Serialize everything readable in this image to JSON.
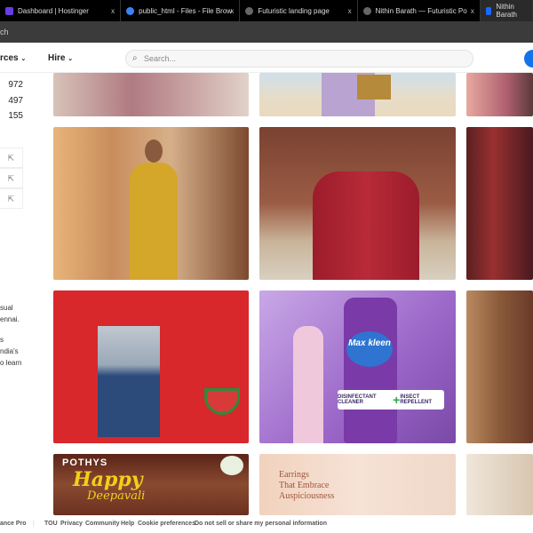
{
  "browser": {
    "tabs": [
      {
        "title": "Dashboard | Hostinger",
        "icon": "hostinger-icon",
        "color": "#673de6"
      },
      {
        "title": "public_html - Files - File Brow",
        "icon": "file-browser-icon",
        "color": "#3b82f6"
      },
      {
        "title": "Futuristic landing page",
        "icon": "openai-icon",
        "color": "#888888"
      },
      {
        "title": "Nithin Barath — Futuristic Po",
        "icon": "globe-icon",
        "color": "#888888"
      },
      {
        "title": "Nithin Barath",
        "icon": "behance-icon",
        "color": "#1769ff"
      }
    ],
    "close": "x",
    "address": "ch"
  },
  "nav": {
    "resources": "rces",
    "hire": "Hire",
    "search_placeholder": "Search..."
  },
  "sidebar": {
    "stats": [
      "972",
      "497",
      "155"
    ],
    "bio": [
      "sual",
      "ennai.",
      "s",
      "ndia's",
      "o learn"
    ]
  },
  "gallery": {
    "pothys": {
      "brand": "POTHYS",
      "happy": "Happy",
      "deepavali": "Deepavali"
    },
    "earrings": [
      "Earrings",
      "That Embrace",
      "Auspiciousness"
    ],
    "maxkleen": {
      "brand": "Max kleen",
      "label1": "DISINFECTANT CLEANER",
      "label2": "INSECT REPELLENT"
    }
  },
  "footer": {
    "brand": "ance Pro",
    "links": [
      "TOU",
      "Privacy",
      "Community",
      "Help",
      "Cookie preferences",
      "Do not sell or share my personal information"
    ]
  },
  "colors": {
    "accent": "#1473e6"
  }
}
